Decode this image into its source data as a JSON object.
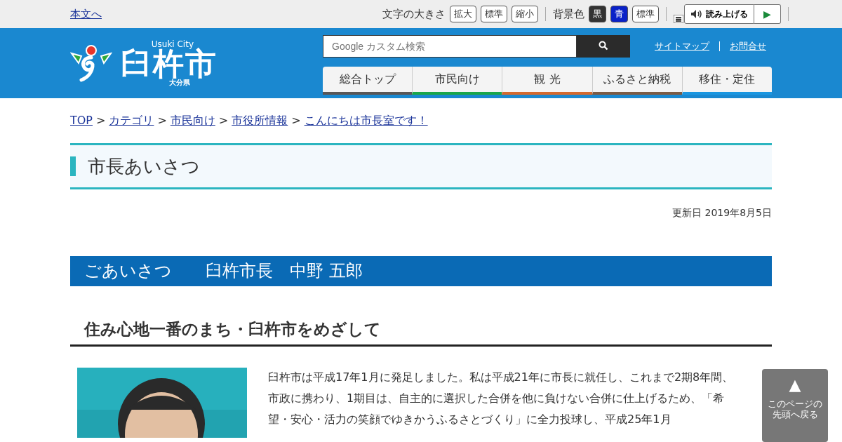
{
  "topbar": {
    "skip_link": "本文へ",
    "font_size_label": "文字の大きさ",
    "font_buttons": [
      "拡大",
      "標準",
      "縮小"
    ],
    "bg_label": "背景色",
    "bg_buttons": [
      {
        "label": "黒",
        "kind": "black"
      },
      {
        "label": "青",
        "kind": "blue"
      },
      {
        "label": "標準",
        "kind": "standard"
      }
    ],
    "read_aloud": "読み上げる",
    "play": "▶"
  },
  "header": {
    "logo_en": "Usuki City",
    "logo_name": "臼杵市",
    "logo_pref": "大分県",
    "search": {
      "placeholder": "Google カスタム検索"
    },
    "links": [
      "サイトマップ",
      "お問合せ"
    ],
    "nav": [
      {
        "label": "総合トップ",
        "color": "#595757"
      },
      {
        "label": "市民向け",
        "color": "#1aa64a"
      },
      {
        "label": "観 光",
        "color": "#d2692f"
      },
      {
        "label": "ふるさと納税",
        "color": "#7b5b45"
      },
      {
        "label": "移住・定住",
        "color": "#1a96e0"
      }
    ]
  },
  "breadcrumb": [
    {
      "kind": "link",
      "text": "TOP"
    },
    {
      "kind": "separator",
      "text": ">"
    },
    {
      "kind": "link",
      "text": "カテゴリ"
    },
    {
      "kind": "separator",
      "text": ">"
    },
    {
      "kind": "link",
      "text": "市民向け"
    },
    {
      "kind": "separator",
      "text": ">"
    },
    {
      "kind": "link",
      "text": "市役所情報"
    },
    {
      "kind": "separator",
      "text": ">"
    },
    {
      "kind": "link",
      "text": "こんにちは市長室です！"
    }
  ],
  "page_title": "市長あいさつ",
  "updated": "更新日 2019年8月5日",
  "section_title": "ごあいさつ　　臼杵市長　中野 五郎",
  "subheading": "住み心地一番のまち・臼杵市をめざして",
  "paragraph": "臼杵市は平成17年1月に発足しました。私は平成21年に市長に就任し、これまで2期8年間、市政に携わり、1期目は、自主的に選択した合併を他に負けない合併に仕上げるため、「希望・安心・活力の笑顔でゆきかうふるさとづくり」に全力投球し、平成25年1月",
  "back_to_top": {
    "arrow": "▲",
    "label": "このページの先頭へ戻る"
  }
}
